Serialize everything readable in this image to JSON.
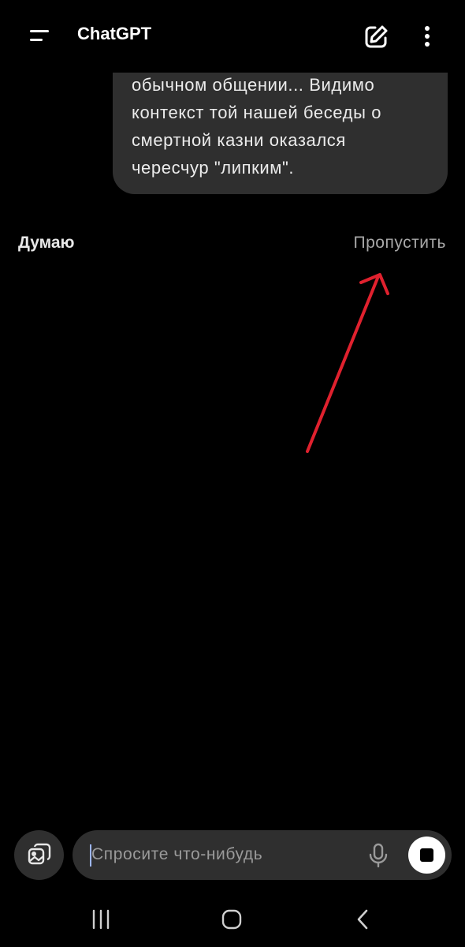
{
  "header": {
    "title": "ChatGPT",
    "icons": {
      "menu": "menu-icon",
      "new_chat": "edit-icon",
      "more": "more-vertical-icon"
    }
  },
  "conversation": {
    "user_message_lines": [
      "обычном общении... Видимо",
      "контекст той нашей беседы о",
      "смертной казни оказался",
      "чересчур \"липким\"."
    ]
  },
  "thinking": {
    "status_label": "Думаю",
    "skip_label": "Пропустить"
  },
  "composer": {
    "placeholder": "Спросите что-нибудь",
    "value": "",
    "icons": {
      "attach": "image-attach-icon",
      "mic": "microphone-icon",
      "stop": "stop-icon"
    }
  },
  "navigation": {
    "icons": [
      "recent-apps-icon",
      "home-icon",
      "back-icon"
    ]
  },
  "colors": {
    "background": "#000000",
    "bubble": "#2f2f2f",
    "annotation_arrow": "#e0212e"
  }
}
